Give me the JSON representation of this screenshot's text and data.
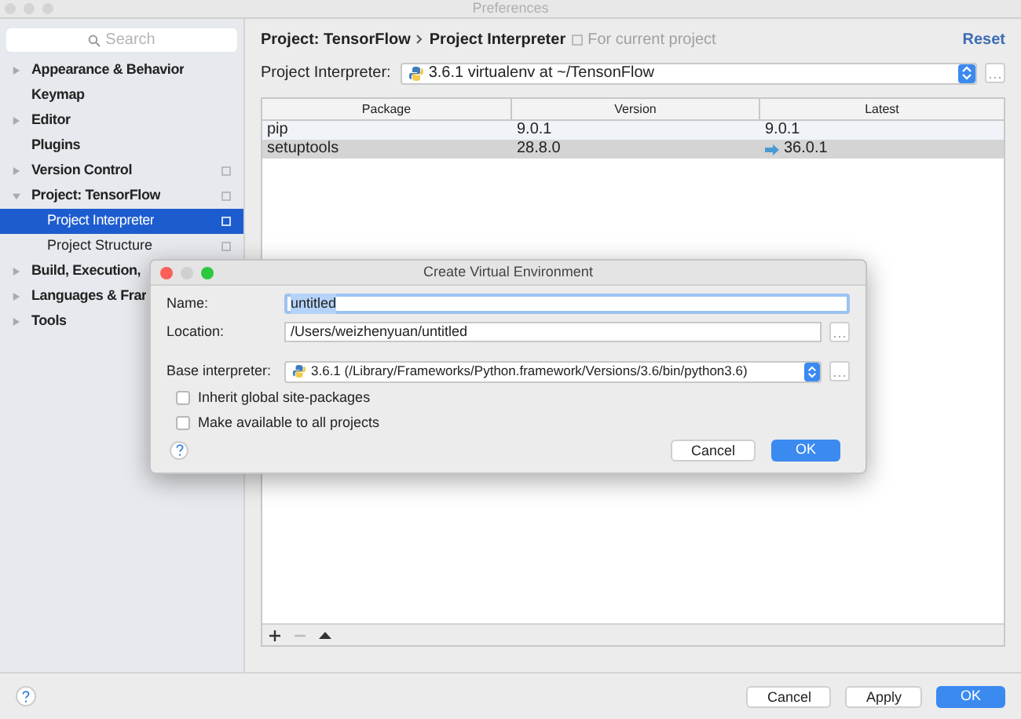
{
  "window": {
    "title": "Preferences"
  },
  "sidebar": {
    "search": {
      "placeholder": "Search"
    },
    "items": [
      {
        "label": "Appearance & Behavior",
        "expanded": false,
        "selected": false
      },
      {
        "label": "Keymap",
        "selected": false
      },
      {
        "label": "Editor",
        "expanded": false,
        "selected": false
      },
      {
        "label": "Plugins",
        "selected": false
      },
      {
        "label": "Version Control",
        "expanded": false,
        "selected": false,
        "project_scoped": true
      },
      {
        "label": "Project: TensorFlow",
        "expanded": true,
        "selected": false,
        "project_scoped": true,
        "children": [
          {
            "label": "Project Interpreter",
            "selected": true,
            "project_scoped": true
          },
          {
            "label": "Project Structure",
            "selected": false,
            "project_scoped": true
          }
        ]
      },
      {
        "label": "Build, Execution,",
        "expanded": false,
        "selected": false
      },
      {
        "label": "Languages & Frar",
        "expanded": false,
        "selected": false
      },
      {
        "label": "Tools",
        "expanded": false,
        "selected": false
      }
    ]
  },
  "header": {
    "breadcrumb": [
      "Project: TensorFlow",
      "Project Interpreter"
    ],
    "note": "For current project",
    "reset": "Reset"
  },
  "interpreter": {
    "label": "Project Interpreter:",
    "value": "3.6.1 virtualenv at ~/TensonFlow"
  },
  "table": {
    "columns": [
      "Package",
      "Version",
      "Latest"
    ],
    "rows": [
      {
        "cells": [
          "pip",
          "9.0.1",
          "9.0.1"
        ],
        "upgrade": false,
        "selected": false
      },
      {
        "cells": [
          "setuptools",
          "28.8.0",
          "36.0.1"
        ],
        "upgrade": true,
        "selected": true
      }
    ]
  },
  "footer_buttons": [
    {
      "label": "Cancel",
      "default": false
    },
    {
      "label": "Apply",
      "default": false
    },
    {
      "label": "OK",
      "default": true
    }
  ],
  "dialog": {
    "title": "Create Virtual Environment",
    "name": {
      "label": "Name:",
      "value": "untitled",
      "text_selected": true
    },
    "location": {
      "label": "Location:",
      "value": "/Users/weizhenyuan/untitled"
    },
    "base": {
      "label": "Base interpreter:",
      "value": "3.6.1 (/Library/Frameworks/Python.framework/Versions/3.6/bin/python3.6)"
    },
    "options": [
      {
        "label": "Inherit global site-packages",
        "checked": false
      },
      {
        "label": "Make available to all projects",
        "checked": false
      }
    ],
    "buttons": [
      {
        "label": "Cancel",
        "default": false
      },
      {
        "label": "OK",
        "default": true
      }
    ]
  }
}
